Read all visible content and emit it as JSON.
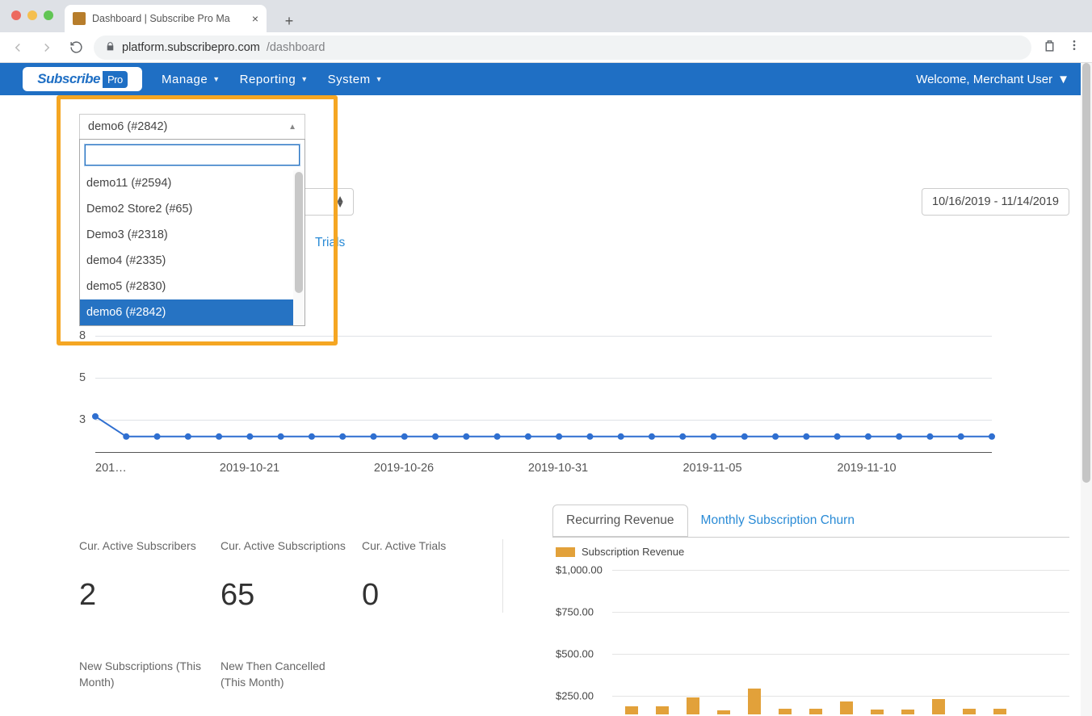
{
  "browser": {
    "tab_title": "Dashboard | Subscribe Pro Ma",
    "url_host": "platform.subscribepro.com",
    "url_path": "/dashboard",
    "traffic_colors": [
      "#ec6a5f",
      "#f5bf4f",
      "#61c554"
    ]
  },
  "header": {
    "logo_text": "Subscribe",
    "logo_suffix": "Pro",
    "menus": [
      "Manage",
      "Reporting",
      "System"
    ],
    "welcome": "Welcome, Merchant User"
  },
  "env_dropdown": {
    "selected": "demo6 (#2842)",
    "options": [
      "demo11 (#2594)",
      "Demo2 Store2 (#65)",
      "Demo3 (#2318)",
      "demo4 (#2335)",
      "demo5 (#2830)",
      "demo6 (#2842)"
    ],
    "selected_index": 5
  },
  "daterange": "10/16/2019 - 11/14/2019",
  "tab_links": {
    "trials": "Trials"
  },
  "stats": {
    "cur_active_subscribers": {
      "label": "Cur. Active Subscribers",
      "value": "2"
    },
    "cur_active_subscriptions": {
      "label": "Cur. Active Subscriptions",
      "value": "65"
    },
    "cur_active_trials": {
      "label": "Cur. Active Trials",
      "value": "0"
    },
    "new_subscriptions_month": {
      "label": "New Subscriptions (This Month)"
    },
    "new_then_cancelled_month": {
      "label": "New Then Cancelled (This Month)"
    }
  },
  "revenue_tabs": {
    "recurring": "Recurring Revenue",
    "churn": "Monthly Subscription Churn",
    "legend": "Subscription Revenue"
  },
  "chart_data": [
    {
      "type": "line",
      "name": "daily_metric_chart",
      "x": [
        "2019-10-16",
        "2019-10-17",
        "2019-10-18",
        "2019-10-19",
        "2019-10-20",
        "2019-10-21",
        "2019-10-22",
        "2019-10-23",
        "2019-10-24",
        "2019-10-25",
        "2019-10-26",
        "2019-10-27",
        "2019-10-28",
        "2019-10-29",
        "2019-10-30",
        "2019-10-31",
        "2019-11-01",
        "2019-11-02",
        "2019-11-03",
        "2019-11-04",
        "2019-11-05",
        "2019-11-06",
        "2019-11-07",
        "2019-11-08",
        "2019-11-09",
        "2019-11-10",
        "2019-11-11",
        "2019-11-12",
        "2019-11-13",
        "2019-11-14"
      ],
      "values": [
        3.2,
        2,
        2,
        2,
        2,
        2,
        2,
        2,
        2,
        2,
        2,
        2,
        2,
        2,
        2,
        2,
        2,
        2,
        2,
        2,
        2,
        2,
        2,
        2,
        2,
        2,
        2,
        2,
        2,
        2
      ],
      "y_ticks": [
        3,
        5,
        8
      ],
      "x_tick_labels": [
        "201…",
        "2019-10-21",
        "2019-10-26",
        "2019-10-31",
        "2019-11-05",
        "2019-11-10"
      ],
      "x_tick_indices": [
        0,
        5,
        10,
        15,
        20,
        25
      ],
      "series_color": "#2f6fd0",
      "approximate": true
    },
    {
      "type": "bar",
      "name": "recurring_revenue_chart",
      "title": "Subscription Revenue",
      "categories_note": "monthly buckets (labels cut off at viewport bottom)",
      "values": [
        80,
        80,
        175,
        40,
        265,
        60,
        60,
        130,
        50,
        50,
        160,
        60,
        60
      ],
      "y_ticks": [
        "$1,000.00",
        "$750.00",
        "$500.00",
        "$250.00"
      ],
      "ylim": [
        0,
        1000
      ],
      "bar_color": "#e2a13a",
      "approximate": true
    }
  ]
}
